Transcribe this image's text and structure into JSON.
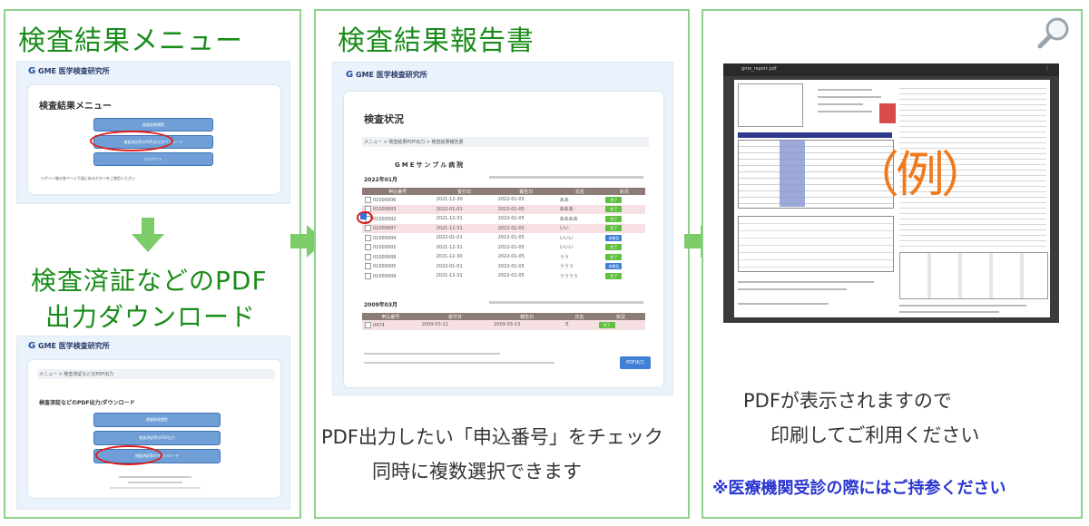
{
  "panel1": {
    "title": "検査結果メニュー",
    "subtitle": "検査済証などのPDF\n出力ダウンロード",
    "subtitle_line1": "検査済証などのPDF",
    "subtitle_line2": "出力ダウンロード",
    "shot1": {
      "logo": "GME 医学検査研究所",
      "heading": "検査結果メニュー",
      "buttons": [
        "検査結果閲覧",
        "検査済証等のPDF出力/ダウンロード",
        "ログアウト"
      ],
      "footer": "ログイン後の各ページ下部に戻るボタンをご使用ください"
    },
    "shot2": {
      "logo": "GME 医学検査研究所",
      "breadcrumb": "メニュー > 検査済証などのPDF出力",
      "heading": "検査済証などのPDF出力/ダウンロード",
      "buttons": [
        "検査結果閲覧",
        "検査済証等のPDF出力",
        "検査済証等のダウンロード"
      ]
    }
  },
  "panel2": {
    "title": "検査結果報告書",
    "caption_line1": "PDF出力したい「申込番号」をチェック",
    "caption_line2": "同時に複数選択できます",
    "shot": {
      "logo": "GME 医学検査研究所",
      "heading": "検査状況",
      "breadcrumb": "メニュー > 検査結果PDF出力 > 検査結果報告書",
      "org": "GMEサンプル病院",
      "year1": "2022年01月",
      "year2": "2009年03月",
      "headers": [
        "申込番号",
        "受付日",
        "報告日",
        "氏名",
        "状況"
      ],
      "rows1": [
        {
          "id": "01000006",
          "d1": "2021-12-30",
          "d2": "2022-01-05",
          "name": "ああ",
          "status": "完了",
          "blue": false,
          "pink": false
        },
        {
          "id": "01000003",
          "d1": "2022-01-01",
          "d2": "2022-01-05",
          "name": "あああ",
          "status": "完了",
          "blue": false,
          "pink": true
        },
        {
          "id": "01000002",
          "d1": "2021-12-31",
          "d2": "2022-01-05",
          "name": "ああああ",
          "status": "完了",
          "blue": false,
          "pink": false
        },
        {
          "id": "01000007",
          "d1": "2021-12-31",
          "d2": "2022-01-05",
          "name": "いい",
          "status": "完了",
          "blue": false,
          "pink": true
        },
        {
          "id": "01000004",
          "d1": "2022-01-01",
          "d2": "2022-01-05",
          "name": "いいい",
          "status": "未報告",
          "blue": true,
          "pink": false
        },
        {
          "id": "01000001",
          "d1": "2021-12-31",
          "d2": "2022-01-05",
          "name": "いいい",
          "status": "完了",
          "blue": false,
          "pink": false
        },
        {
          "id": "01000008",
          "d1": "2021-12-30",
          "d2": "2022-01-05",
          "name": "うう",
          "status": "完了",
          "blue": false,
          "pink": false
        },
        {
          "id": "01000005",
          "d1": "2022-01-01",
          "d2": "2022-01-05",
          "name": "ううう",
          "status": "未報告",
          "blue": true,
          "pink": false
        },
        {
          "id": "01000009",
          "d1": "2021-12-31",
          "d2": "2022-01-05",
          "name": "うううう",
          "status": "完了",
          "blue": false,
          "pink": false
        }
      ],
      "rows2": [
        {
          "id": "0474",
          "d1": "2009-03-11",
          "d2": "2009-03-13",
          "name": "E",
          "status": "完了",
          "blue": false,
          "pink": true
        }
      ],
      "button": "PDF出力"
    }
  },
  "panel3": {
    "search_icon": "magnifier-icon",
    "stamp": "（例）",
    "caption_line1": "PDFが表示されますので",
    "caption_line2": "印刷してご利用ください",
    "note": "※医療機関受診の際にはご持参ください",
    "viewer_title": "gme_report.pdf"
  },
  "colors": {
    "border": "#8fd08a",
    "title": "#1a8c1a",
    "arrow": "#7ccc6a",
    "note": "#2a36d0",
    "stamp": "#f07a1e"
  }
}
